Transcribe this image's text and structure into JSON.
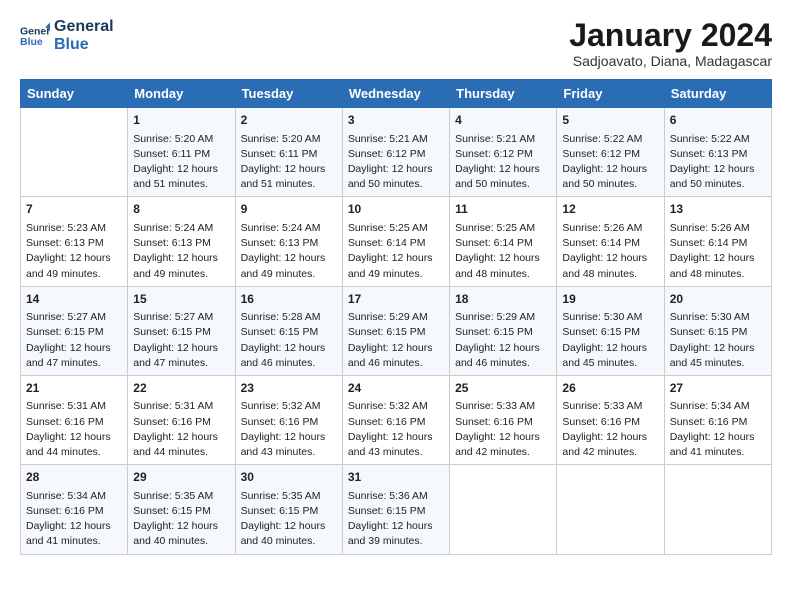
{
  "logo": {
    "line1": "General",
    "line2": "Blue"
  },
  "title": "January 2024",
  "subtitle": "Sadjoavato, Diana, Madagascar",
  "headers": [
    "Sunday",
    "Monday",
    "Tuesday",
    "Wednesday",
    "Thursday",
    "Friday",
    "Saturday"
  ],
  "weeks": [
    [
      {
        "day": "",
        "lines": []
      },
      {
        "day": "1",
        "lines": [
          "Sunrise: 5:20 AM",
          "Sunset: 6:11 PM",
          "Daylight: 12 hours",
          "and 51 minutes."
        ]
      },
      {
        "day": "2",
        "lines": [
          "Sunrise: 5:20 AM",
          "Sunset: 6:11 PM",
          "Daylight: 12 hours",
          "and 51 minutes."
        ]
      },
      {
        "day": "3",
        "lines": [
          "Sunrise: 5:21 AM",
          "Sunset: 6:12 PM",
          "Daylight: 12 hours",
          "and 50 minutes."
        ]
      },
      {
        "day": "4",
        "lines": [
          "Sunrise: 5:21 AM",
          "Sunset: 6:12 PM",
          "Daylight: 12 hours",
          "and 50 minutes."
        ]
      },
      {
        "day": "5",
        "lines": [
          "Sunrise: 5:22 AM",
          "Sunset: 6:12 PM",
          "Daylight: 12 hours",
          "and 50 minutes."
        ]
      },
      {
        "day": "6",
        "lines": [
          "Sunrise: 5:22 AM",
          "Sunset: 6:13 PM",
          "Daylight: 12 hours",
          "and 50 minutes."
        ]
      }
    ],
    [
      {
        "day": "7",
        "lines": [
          "Sunrise: 5:23 AM",
          "Sunset: 6:13 PM",
          "Daylight: 12 hours",
          "and 49 minutes."
        ]
      },
      {
        "day": "8",
        "lines": [
          "Sunrise: 5:24 AM",
          "Sunset: 6:13 PM",
          "Daylight: 12 hours",
          "and 49 minutes."
        ]
      },
      {
        "day": "9",
        "lines": [
          "Sunrise: 5:24 AM",
          "Sunset: 6:13 PM",
          "Daylight: 12 hours",
          "and 49 minutes."
        ]
      },
      {
        "day": "10",
        "lines": [
          "Sunrise: 5:25 AM",
          "Sunset: 6:14 PM",
          "Daylight: 12 hours",
          "and 49 minutes."
        ]
      },
      {
        "day": "11",
        "lines": [
          "Sunrise: 5:25 AM",
          "Sunset: 6:14 PM",
          "Daylight: 12 hours",
          "and 48 minutes."
        ]
      },
      {
        "day": "12",
        "lines": [
          "Sunrise: 5:26 AM",
          "Sunset: 6:14 PM",
          "Daylight: 12 hours",
          "and 48 minutes."
        ]
      },
      {
        "day": "13",
        "lines": [
          "Sunrise: 5:26 AM",
          "Sunset: 6:14 PM",
          "Daylight: 12 hours",
          "and 48 minutes."
        ]
      }
    ],
    [
      {
        "day": "14",
        "lines": [
          "Sunrise: 5:27 AM",
          "Sunset: 6:15 PM",
          "Daylight: 12 hours",
          "and 47 minutes."
        ]
      },
      {
        "day": "15",
        "lines": [
          "Sunrise: 5:27 AM",
          "Sunset: 6:15 PM",
          "Daylight: 12 hours",
          "and 47 minutes."
        ]
      },
      {
        "day": "16",
        "lines": [
          "Sunrise: 5:28 AM",
          "Sunset: 6:15 PM",
          "Daylight: 12 hours",
          "and 46 minutes."
        ]
      },
      {
        "day": "17",
        "lines": [
          "Sunrise: 5:29 AM",
          "Sunset: 6:15 PM",
          "Daylight: 12 hours",
          "and 46 minutes."
        ]
      },
      {
        "day": "18",
        "lines": [
          "Sunrise: 5:29 AM",
          "Sunset: 6:15 PM",
          "Daylight: 12 hours",
          "and 46 minutes."
        ]
      },
      {
        "day": "19",
        "lines": [
          "Sunrise: 5:30 AM",
          "Sunset: 6:15 PM",
          "Daylight: 12 hours",
          "and 45 minutes."
        ]
      },
      {
        "day": "20",
        "lines": [
          "Sunrise: 5:30 AM",
          "Sunset: 6:15 PM",
          "Daylight: 12 hours",
          "and 45 minutes."
        ]
      }
    ],
    [
      {
        "day": "21",
        "lines": [
          "Sunrise: 5:31 AM",
          "Sunset: 6:16 PM",
          "Daylight: 12 hours",
          "and 44 minutes."
        ]
      },
      {
        "day": "22",
        "lines": [
          "Sunrise: 5:31 AM",
          "Sunset: 6:16 PM",
          "Daylight: 12 hours",
          "and 44 minutes."
        ]
      },
      {
        "day": "23",
        "lines": [
          "Sunrise: 5:32 AM",
          "Sunset: 6:16 PM",
          "Daylight: 12 hours",
          "and 43 minutes."
        ]
      },
      {
        "day": "24",
        "lines": [
          "Sunrise: 5:32 AM",
          "Sunset: 6:16 PM",
          "Daylight: 12 hours",
          "and 43 minutes."
        ]
      },
      {
        "day": "25",
        "lines": [
          "Sunrise: 5:33 AM",
          "Sunset: 6:16 PM",
          "Daylight: 12 hours",
          "and 42 minutes."
        ]
      },
      {
        "day": "26",
        "lines": [
          "Sunrise: 5:33 AM",
          "Sunset: 6:16 PM",
          "Daylight: 12 hours",
          "and 42 minutes."
        ]
      },
      {
        "day": "27",
        "lines": [
          "Sunrise: 5:34 AM",
          "Sunset: 6:16 PM",
          "Daylight: 12 hours",
          "and 41 minutes."
        ]
      }
    ],
    [
      {
        "day": "28",
        "lines": [
          "Sunrise: 5:34 AM",
          "Sunset: 6:16 PM",
          "Daylight: 12 hours",
          "and 41 minutes."
        ]
      },
      {
        "day": "29",
        "lines": [
          "Sunrise: 5:35 AM",
          "Sunset: 6:15 PM",
          "Daylight: 12 hours",
          "and 40 minutes."
        ]
      },
      {
        "day": "30",
        "lines": [
          "Sunrise: 5:35 AM",
          "Sunset: 6:15 PM",
          "Daylight: 12 hours",
          "and 40 minutes."
        ]
      },
      {
        "day": "31",
        "lines": [
          "Sunrise: 5:36 AM",
          "Sunset: 6:15 PM",
          "Daylight: 12 hours",
          "and 39 minutes."
        ]
      },
      {
        "day": "",
        "lines": []
      },
      {
        "day": "",
        "lines": []
      },
      {
        "day": "",
        "lines": []
      }
    ]
  ]
}
